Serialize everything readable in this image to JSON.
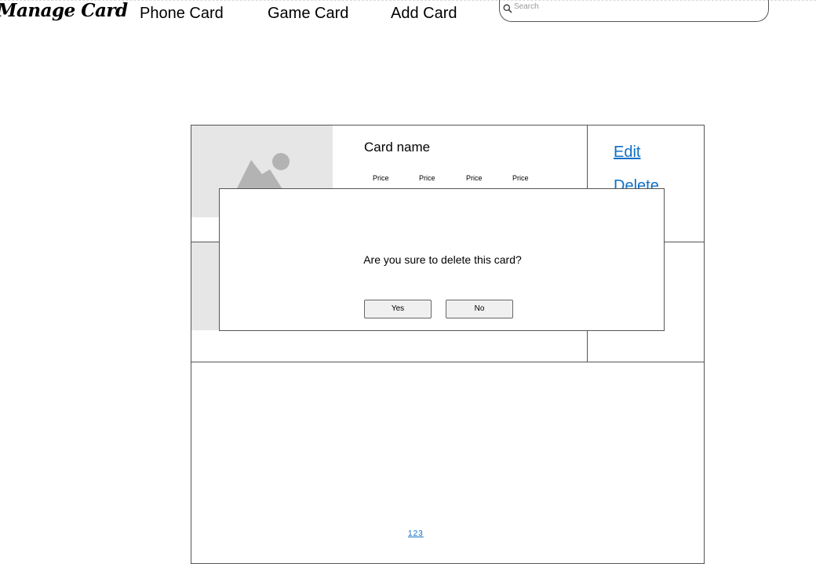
{
  "header": {
    "brand": "Manage Card",
    "nav": [
      {
        "label": "Phone Card"
      },
      {
        "label": "Game Card"
      },
      {
        "label": "Add Card"
      }
    ],
    "search": {
      "placeholder": "Search",
      "value": ""
    }
  },
  "card": {
    "name": "Card name",
    "prices": [
      "Price",
      "Price",
      "Price",
      "Price"
    ],
    "actions": {
      "edit": "Edit",
      "delete": "Delete"
    }
  },
  "pagination": [
    "1",
    "2",
    "3"
  ],
  "dialog": {
    "message": "Are you sure to delete this card?",
    "yes_label": "Yes",
    "no_label": "No"
  },
  "colors": {
    "link": "#0f6fc6",
    "placeholder_bg": "#e6e6e6",
    "placeholder_fg": "#b3b3b3",
    "border": "#555555"
  }
}
